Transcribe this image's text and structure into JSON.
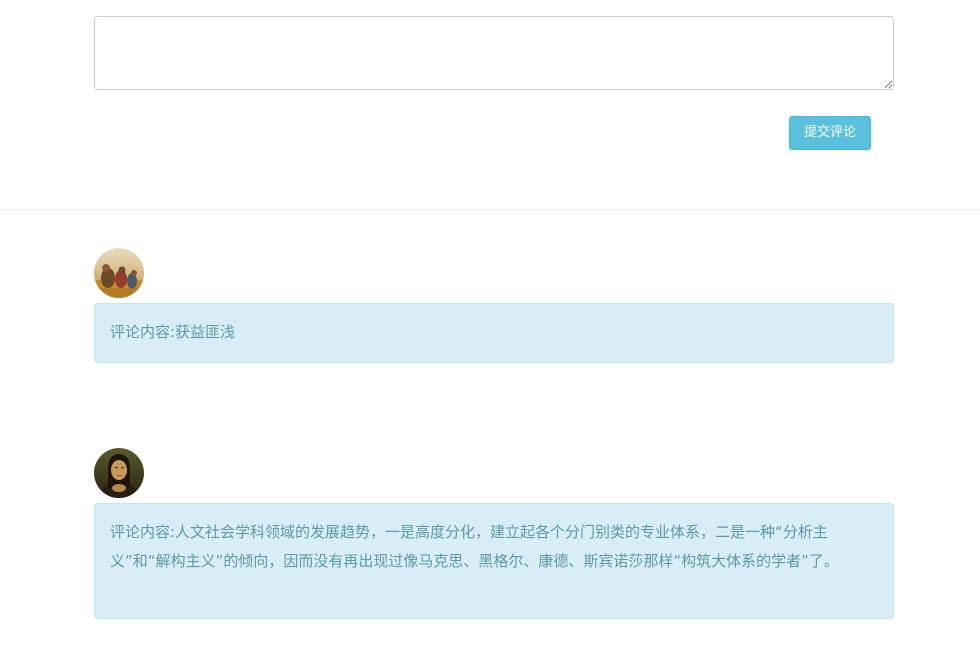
{
  "comment_form": {
    "textarea_value": "",
    "submit_label": "提交评论"
  },
  "comments": [
    {
      "avatar_icon": "avatar-painting-harvest-icon",
      "text": "评论内容:获益匪浅"
    },
    {
      "avatar_icon": "avatar-mona-lisa-icon",
      "text": "评论内容:人文社会学科领域的发展趋势，一是高度分化，建立起各个分门别类的专业体系，二是一种“分析主义”和“解构主义”的倾向，因而没有再出现过像马克思、黑格尔、康德、斯宾诺莎那样“构筑大体系的学者”了。"
    }
  ],
  "colors": {
    "button_bg": "#5bc0de",
    "comment_bg": "#d9edf7",
    "comment_border": "#bce8f1",
    "comment_text": "#5b9aa8"
  }
}
